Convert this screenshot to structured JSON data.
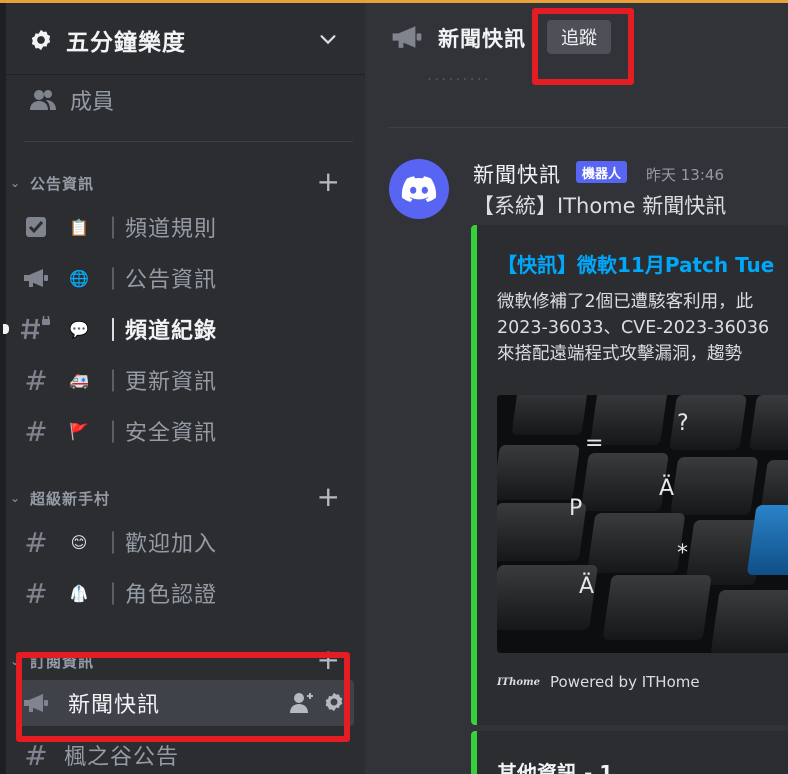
{
  "server": {
    "name": "五分鐘樂度"
  },
  "sidebar": {
    "members_label": "成員",
    "categories": [
      {
        "label": "公告資訊",
        "channels": [
          {
            "emoji": "📋",
            "name": "｜頻道規則",
            "icon": "rules-checkbox-icon"
          },
          {
            "emoji": "🌐",
            "name": "｜公告資訊",
            "icon": "announcement-icon"
          },
          {
            "emoji": "💬",
            "name": "｜頻道紀錄",
            "icon": "hashtag-locked-icon"
          },
          {
            "emoji": "🚑",
            "name": "｜更新資訊",
            "icon": "hashtag-icon"
          },
          {
            "emoji": "🚩",
            "name": "｜安全資訊",
            "icon": "hashtag-icon"
          }
        ]
      },
      {
        "label": "超級新手村",
        "channels": [
          {
            "emoji": "😊",
            "name": "｜歡迎加入",
            "icon": "hashtag-icon"
          },
          {
            "emoji": "🥼",
            "name": "｜角色認證",
            "icon": "hashtag-icon"
          }
        ]
      },
      {
        "label": "訂閱資訊",
        "channels": [
          {
            "emoji": "",
            "name": "新聞快訊",
            "icon": "announcement-icon"
          },
          {
            "emoji": "",
            "name": "楓之谷公告",
            "icon": "hashtag-icon"
          }
        ]
      }
    ]
  },
  "header": {
    "channel_name": "新聞快訊",
    "follow_label": "追蹤",
    "ghost_text": "........."
  },
  "message": {
    "author": "新聞快訊",
    "bot_tag": "機器人",
    "timestamp": "昨天 13:46",
    "content": "【系統】IThome 新聞快訊",
    "embed": {
      "title": "【快訊】微軟11月Patch Tue",
      "description": [
        "微軟修補了2個已遭駭客利用，此",
        "2023-36033、CVE-2023-36036",
        "來搭配遠端程式攻擊漏洞，趨勢"
      ],
      "footer_logo": "IThome",
      "footer_text": "Powered by ITHome"
    },
    "embed2": {
      "title": "其他資訊 - 1"
    }
  },
  "colors": {
    "accent_top": "#e9a23b",
    "embed_border": "#36d13b",
    "embed_title": "#00a8fc",
    "blurple": "#5865f2",
    "highlight_box": "#e41c23"
  }
}
